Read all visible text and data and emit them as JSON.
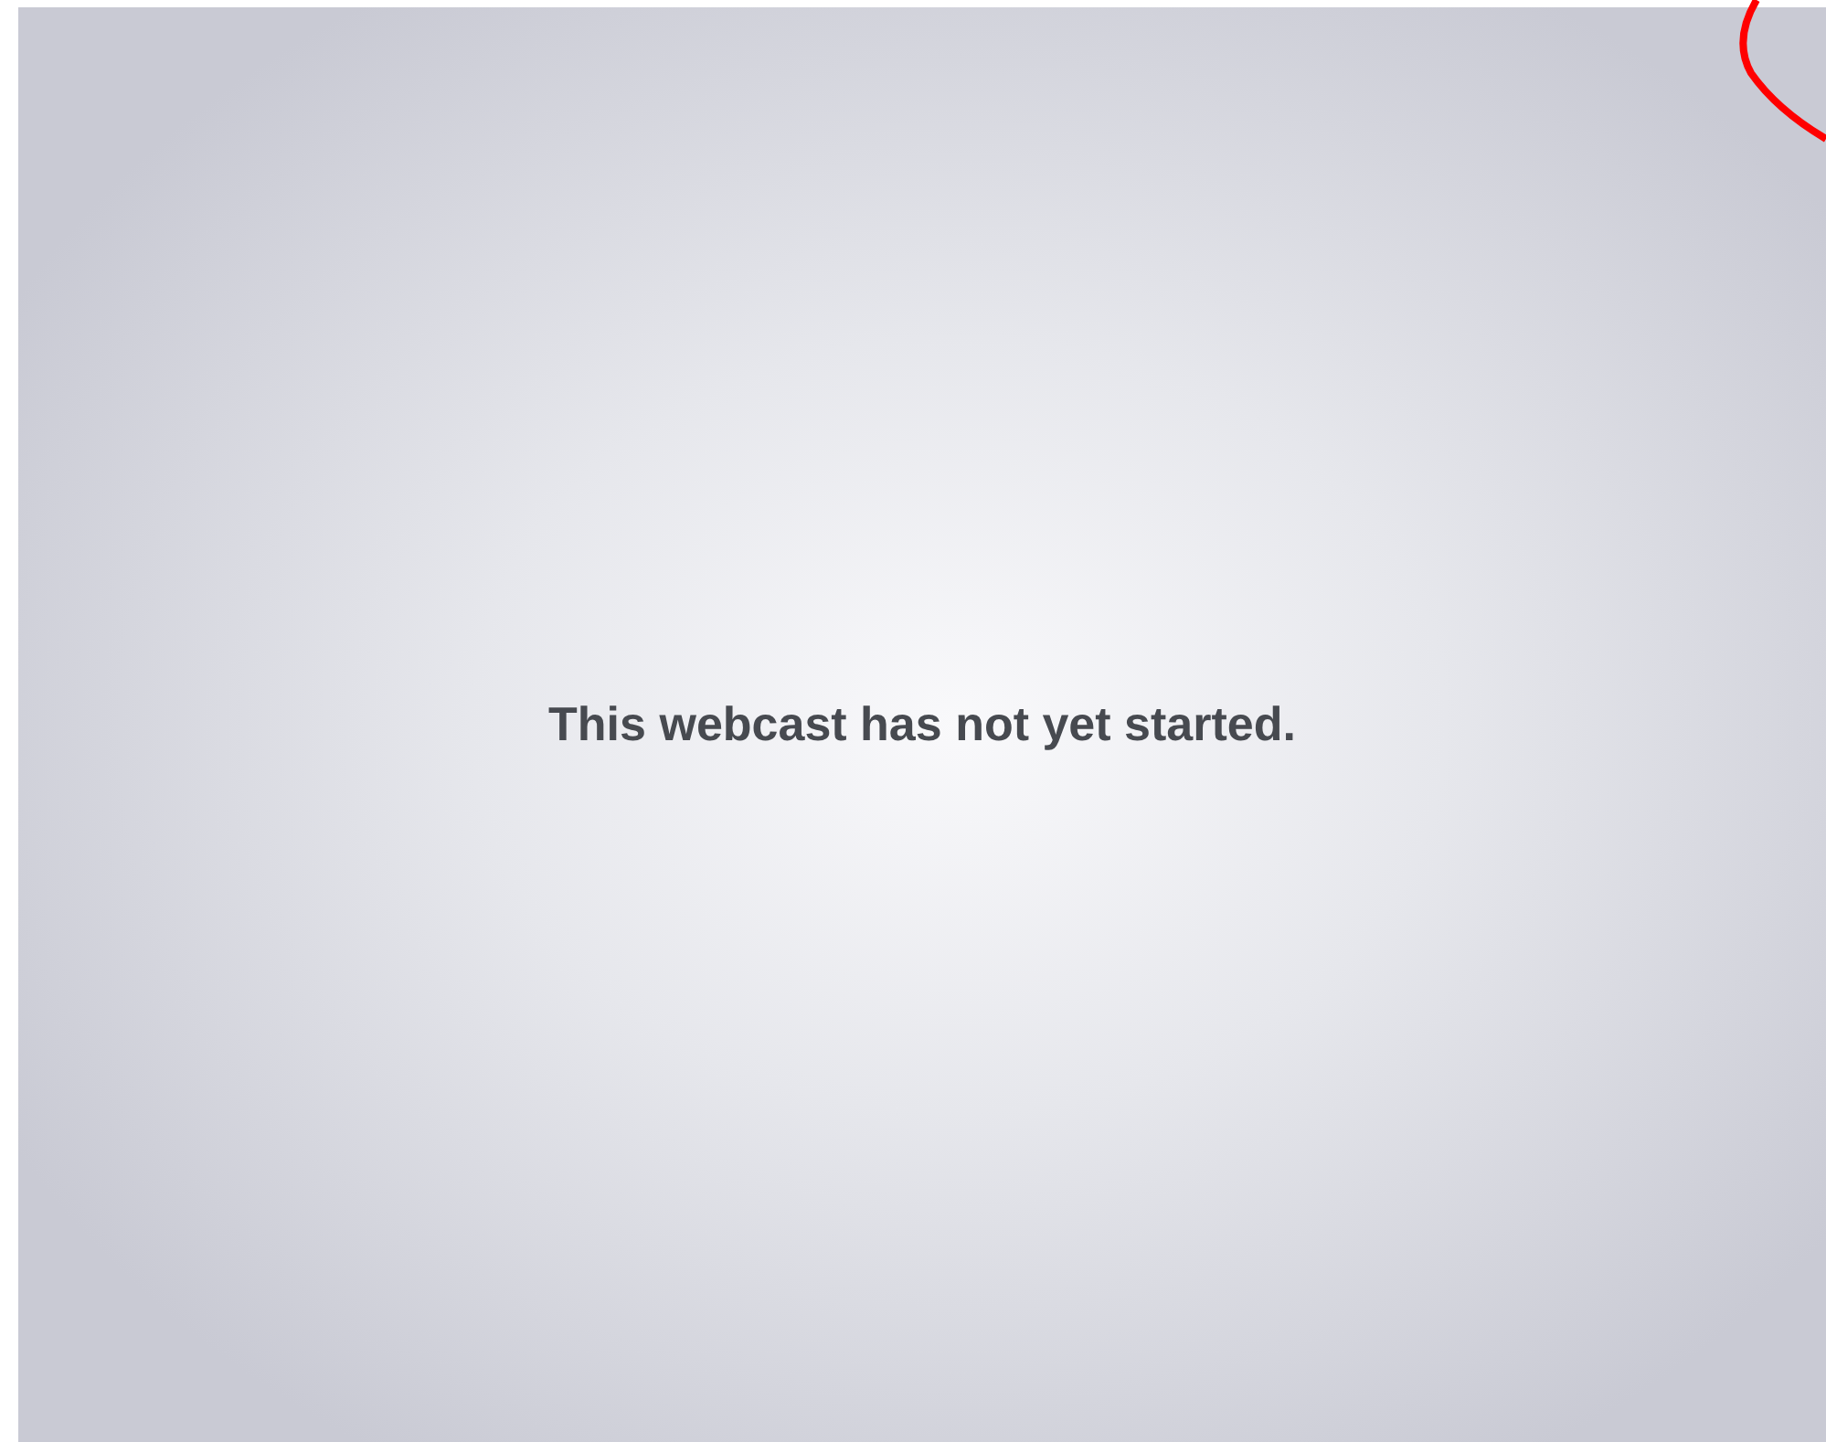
{
  "player": {
    "message": "This webcast has not yet started."
  }
}
